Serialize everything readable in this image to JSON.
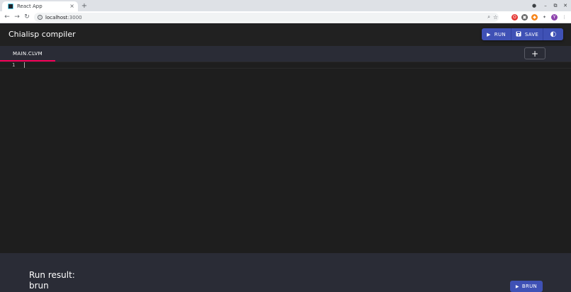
{
  "browser": {
    "tab_title": "React App",
    "tab_close": "×",
    "new_tab": "+",
    "window_controls": {
      "minimize": "–",
      "restore": "⧉",
      "close": "✕",
      "profile": "●"
    },
    "nav": {
      "back": "←",
      "forward": "→",
      "reload": "↻"
    },
    "address": {
      "host": "localhost",
      "port": ":3000"
    },
    "zoom_icon": "⌕",
    "star_icon": "☆",
    "extensions": [
      {
        "name": "opera",
        "glyph": "O",
        "color": "#e53935"
      },
      {
        "name": "extension-badge",
        "glyph": "▣",
        "color": "#616161"
      },
      {
        "name": "metamask",
        "glyph": "◆",
        "color": "#f6851b"
      },
      {
        "name": "puzzle",
        "glyph": "✦",
        "color": "#5f6368"
      },
      {
        "name": "profile",
        "glyph": "Y",
        "color": "#8e44ad"
      },
      {
        "name": "menu",
        "glyph": "⋮",
        "color": "#5f6368"
      }
    ]
  },
  "app": {
    "title": "Chialisp compiler",
    "actions": {
      "run_label": "RUN",
      "save_label": "SAVE",
      "run_icon": "▶",
      "save_icon": "💾",
      "theme_icon": "◐"
    },
    "tabs": [
      {
        "label": "MAIN.CLVM",
        "active": true
      }
    ],
    "add_tab_label": "+",
    "editor": {
      "line_numbers": [
        "1"
      ]
    },
    "results": {
      "label": "Run result:",
      "value": "brun",
      "brun_label": "BRUN",
      "brun_icon": "▶"
    },
    "colors": {
      "primary": "#3f51b5",
      "accent": "#f50057",
      "background": "#1e1e1e",
      "surface": "#2a2c36"
    }
  }
}
